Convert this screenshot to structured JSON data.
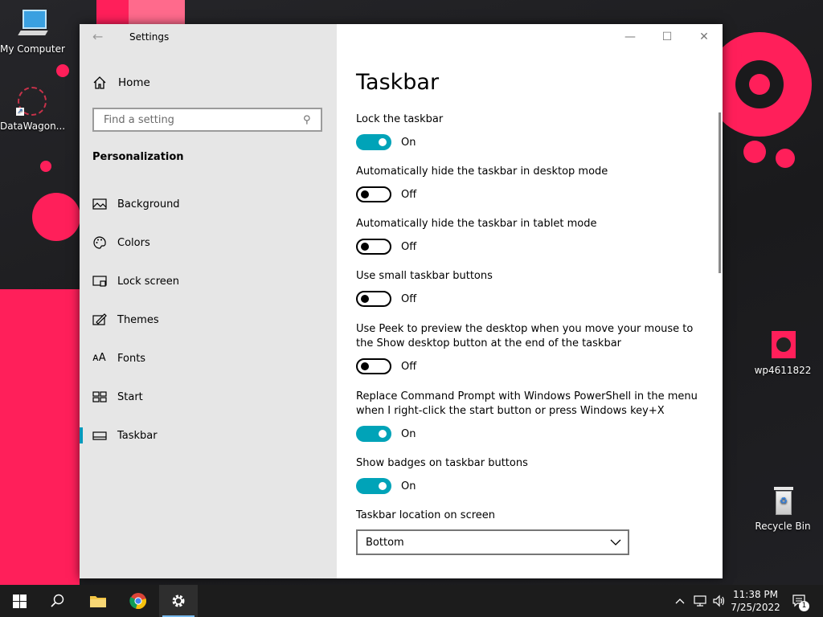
{
  "desktop": {
    "icons": [
      {
        "label": "My Computer"
      },
      {
        "label": "DataWagon..."
      },
      {
        "label": "wp4611822"
      },
      {
        "label": "Recycle Bin"
      }
    ],
    "wallpaper_accent": "#ff1f5a"
  },
  "window": {
    "title": "Settings",
    "controls": {
      "minimize": "—",
      "maximize": "☐",
      "close": "✕"
    }
  },
  "sidebar": {
    "home_label": "Home",
    "search_placeholder": "Find a setting",
    "section": "Personalization",
    "items": [
      {
        "label": "Background",
        "icon": "background-icon"
      },
      {
        "label": "Colors",
        "icon": "palette-icon"
      },
      {
        "label": "Lock screen",
        "icon": "lock-screen-icon"
      },
      {
        "label": "Themes",
        "icon": "themes-icon"
      },
      {
        "label": "Fonts",
        "icon": "fonts-icon"
      },
      {
        "label": "Start",
        "icon": "start-icon"
      },
      {
        "label": "Taskbar",
        "icon": "taskbar-icon",
        "active": true
      }
    ]
  },
  "main": {
    "title": "Taskbar",
    "settings": [
      {
        "title": "Lock the taskbar",
        "state": "On"
      },
      {
        "title": "Automatically hide the taskbar in desktop mode",
        "state": "Off"
      },
      {
        "title": "Automatically hide the taskbar in tablet mode",
        "state": "Off"
      },
      {
        "title": "Use small taskbar buttons",
        "state": "Off"
      },
      {
        "title": "Use Peek to preview the desktop when you move your mouse to the Show desktop button at the end of the taskbar",
        "state": "Off"
      },
      {
        "title": "Replace Command Prompt with Windows PowerShell in the menu when I right-click the start button or press Windows key+X",
        "state": "On"
      },
      {
        "title": "Show badges on taskbar buttons",
        "state": "On"
      }
    ],
    "location": {
      "label": "Taskbar location on screen",
      "value": "Bottom"
    }
  },
  "taskbar": {
    "time": "11:38 PM",
    "date": "7/25/2022",
    "notification_count": "1",
    "accent": "#00a3b8"
  }
}
